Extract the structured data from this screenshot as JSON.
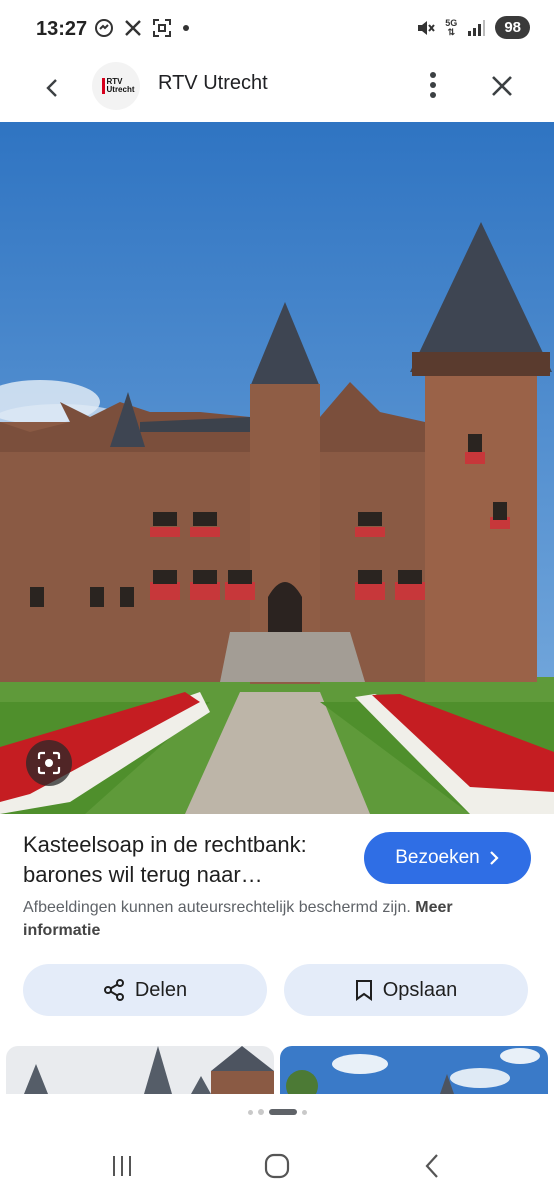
{
  "status_bar": {
    "time": "13:27",
    "network": "5G",
    "battery": "98"
  },
  "app_bar": {
    "site_logo_text": "RTV Utrecht",
    "site_name": "RTV Utrecht"
  },
  "result": {
    "title": "Kasteelsoap in de rechtbank: barones wil terug naar…",
    "visit_label": "Bezoeken",
    "copyright_text": "Afbeeldingen kunnen auteursrechtelijk beschermd zijn.",
    "more_info_label": "Meer informatie"
  },
  "actions": {
    "share_label": "Delen",
    "save_label": "Opslaan"
  },
  "colors": {
    "accent": "#2f6ee5",
    "action_bg": "#e4ecf9",
    "sky": "#3f82c9",
    "brick": "#8a5a44"
  },
  "icons": [
    "messenger-icon",
    "x-icon",
    "screenshot-icon",
    "mute-icon",
    "signal-icon",
    "more-vert-icon",
    "close-icon",
    "back-arrow-icon",
    "lens-icon",
    "chevron-right-icon",
    "share-icon",
    "bookmark-icon",
    "recents-icon",
    "home-icon",
    "nav-back-icon"
  ]
}
